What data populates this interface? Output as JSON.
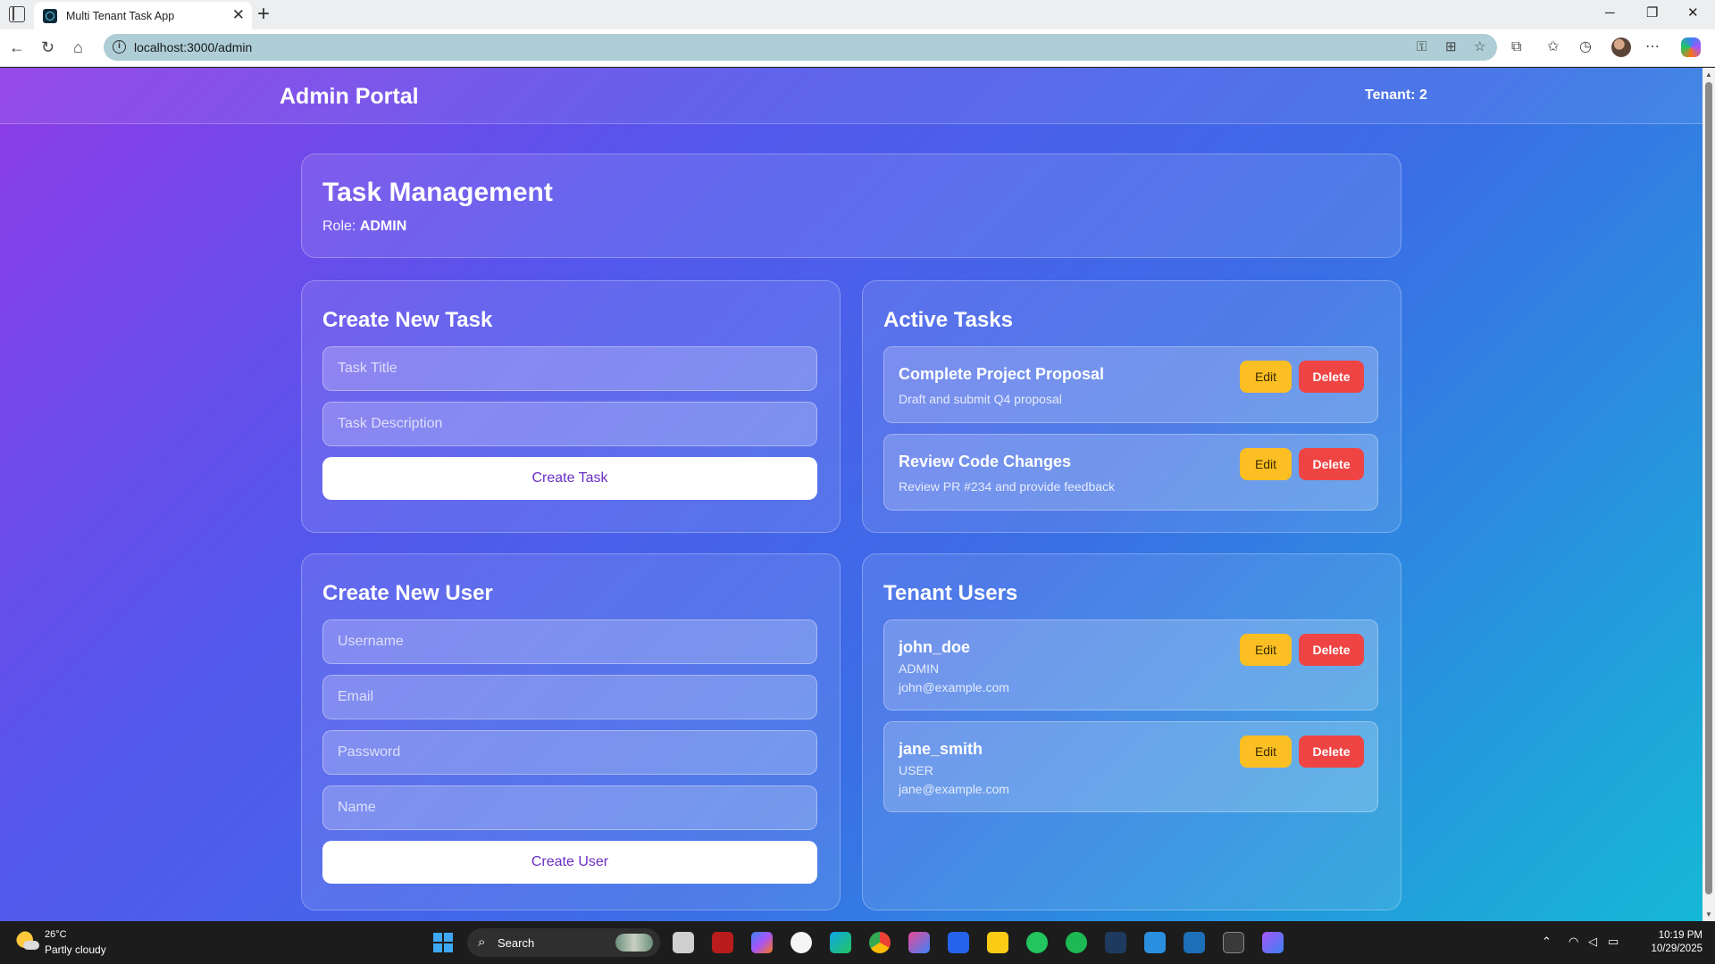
{
  "browser": {
    "tab_title": "Multi Tenant Task App",
    "tab_close": "✕",
    "new_tab": "+",
    "url": "localhost:3000/admin",
    "window_controls": {
      "minimize": "─",
      "maximize": "❐",
      "close": "✕"
    }
  },
  "header": {
    "title": "Admin Portal",
    "tenant": "Tenant: 2"
  },
  "task_management": {
    "title": "Task Management",
    "role_label": "Role:",
    "role_value": "ADMIN"
  },
  "create_task": {
    "title": "Create New Task",
    "title_placeholder": "Task Title",
    "description_placeholder": "Task Description",
    "button": "Create Task"
  },
  "active_tasks": {
    "title": "Active Tasks",
    "items": [
      {
        "title": "Complete Project Proposal",
        "description": "Draft and submit Q4 proposal",
        "edit": "Edit",
        "delete": "Delete"
      },
      {
        "title": "Review Code Changes",
        "description": "Review PR #234 and provide feedback",
        "edit": "Edit",
        "delete": "Delete"
      }
    ]
  },
  "create_user": {
    "title": "Create New User",
    "username_placeholder": "Username",
    "email_placeholder": "Email",
    "password_placeholder": "Password",
    "name_placeholder": "Name",
    "button": "Create User"
  },
  "tenant_users": {
    "title": "Tenant Users",
    "items": [
      {
        "username": "john_doe",
        "role": "ADMIN",
        "email": "john@example.com",
        "edit": "Edit",
        "delete": "Delete"
      },
      {
        "username": "jane_smith",
        "role": "USER",
        "email": "jane@example.com",
        "edit": "Edit",
        "delete": "Delete"
      }
    ]
  },
  "taskbar": {
    "temperature": "26°C",
    "weather": "Partly cloudy",
    "search": "Search",
    "time": "10:19 PM",
    "date": "10/29/2025"
  },
  "colors": {
    "edit_button": "#fbbf24",
    "delete_button": "#ef4444",
    "primary_text": "#6a2fc4"
  }
}
